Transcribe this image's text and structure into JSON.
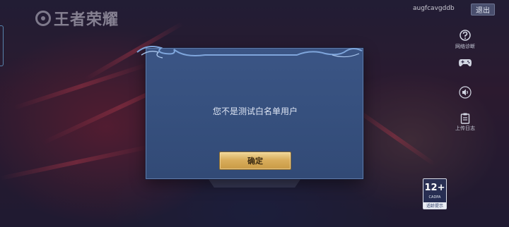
{
  "header": {
    "logo_text": "王者荣耀",
    "username": "augfcavgddb",
    "exit_label": "退出"
  },
  "side_menu": {
    "items": [
      {
        "label": "网络诊断",
        "icon": "question-icon"
      },
      {
        "label": "",
        "icon": "gamepad-icon"
      },
      {
        "label": "",
        "icon": "speaker-icon"
      },
      {
        "label": "上传日志",
        "icon": "clipboard-icon"
      }
    ]
  },
  "dialog": {
    "message": "您不是测试白名单用户",
    "confirm_label": "确定"
  },
  "age_rating": {
    "number": "12+",
    "sub": "CADPA",
    "foot": "适龄提示"
  },
  "colors": {
    "dialog_bg": "#3b5585",
    "button_gold": "#d9ae5c"
  }
}
